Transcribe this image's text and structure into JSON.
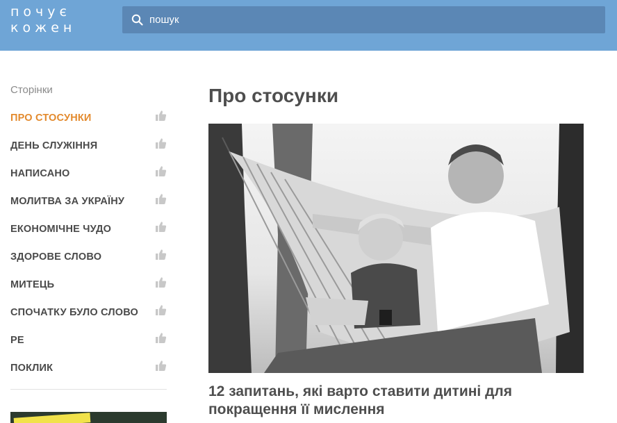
{
  "header": {
    "logo_line1": "почує",
    "logo_line2": "кожен",
    "search_placeholder": "пошук",
    "icons": {
      "search": "search-icon"
    }
  },
  "sidebar": {
    "heading": "Сторінки",
    "items": [
      {
        "label": "ПРО СТОСУНКИ",
        "active": true
      },
      {
        "label": "ДЕНЬ СЛУЖІННЯ"
      },
      {
        "label": "НАПИСАНО"
      },
      {
        "label": "МОЛИТВА ЗА УКРАЇНУ"
      },
      {
        "label": "ЕКОНОМІЧНЕ ЧУДО"
      },
      {
        "label": "ЗДОРОВЕ СЛОВО"
      },
      {
        "label": "МИТЕЦЬ"
      },
      {
        "label": "СПОЧАТКУ БУЛО СЛОВО"
      },
      {
        "label": "РЕ"
      },
      {
        "label": "ПОКЛИК"
      }
    ],
    "item_icon": "thumbs-up-icon"
  },
  "main": {
    "title": "Про стосунки",
    "article": {
      "title": "12 запитань, які варто ставити дитині для покращення її мислення"
    }
  },
  "colors": {
    "header_bg": "#6fa5d6",
    "search_bg": "#5b87b5",
    "active_nav": "#e38a2d",
    "text": "#4a4a4a"
  }
}
